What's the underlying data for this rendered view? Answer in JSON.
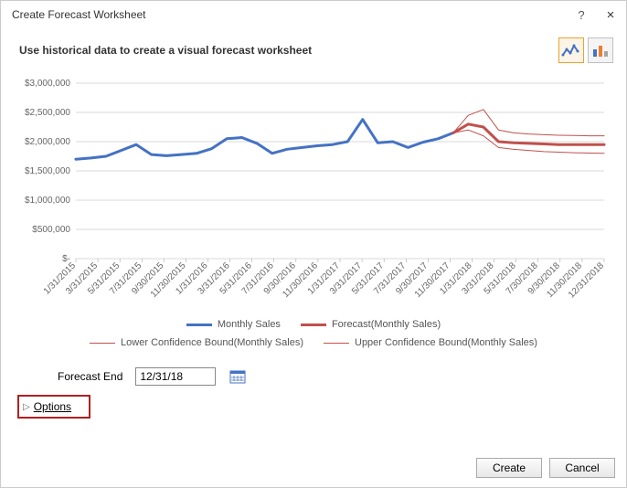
{
  "dialog": {
    "title": "Create Forecast Worksheet",
    "subtitle": "Use historical data to create a visual forecast worksheet",
    "help_tooltip": "?",
    "close_tooltip": "×"
  },
  "chart_types": {
    "line_selected": true,
    "bar_selected": false
  },
  "form": {
    "forecast_end_label": "Forecast End",
    "forecast_end_value": "12/31/18"
  },
  "options": {
    "label": "Options"
  },
  "buttons": {
    "create": "Create",
    "cancel": "Cancel"
  },
  "legend": {
    "monthly_sales": "Monthly Sales",
    "forecast": "Forecast(Monthly Sales)",
    "lower": "Lower Confidence Bound(Monthly Sales)",
    "upper": "Upper Confidence Bound(Monthly Sales)"
  },
  "colors": {
    "historical": "#4472c4",
    "forecast": "#c0504d",
    "bounds": "#c0504d",
    "grid": "#d9d9d9"
  },
  "chart_data": {
    "type": "line",
    "title": "",
    "xlabel": "",
    "ylabel": "",
    "ylim": [
      0,
      3000000
    ],
    "y_ticks": [
      0,
      500000,
      1000000,
      1500000,
      2000000,
      2500000,
      3000000
    ],
    "y_tick_labels": [
      "$-",
      "$500,000",
      "$1,000,000",
      "$1,500,000",
      "$2,000,000",
      "$2,500,000",
      "$3,000,000"
    ],
    "categories": [
      "1/31/2015",
      "3/31/2015",
      "5/31/2015",
      "7/31/2015",
      "9/30/2015",
      "11/30/2015",
      "1/31/2016",
      "3/31/2016",
      "5/31/2016",
      "7/31/2016",
      "9/30/2016",
      "11/30/2016",
      "1/31/2017",
      "3/31/2017",
      "5/31/2017",
      "7/31/2017",
      "9/30/2017",
      "11/30/2017",
      "1/31/2018",
      "3/31/2018",
      "5/31/2018",
      "7/30/2018",
      "9/30/2018",
      "11/30/2018",
      "12/31/2018"
    ],
    "series": [
      {
        "name": "Monthly Sales",
        "color": "#4472c4",
        "width": 3,
        "values": [
          1700000,
          1720000,
          1750000,
          1850000,
          1950000,
          1780000,
          1760000,
          1780000,
          1800000,
          1880000,
          2050000,
          2070000,
          1970000,
          1800000,
          1870000,
          1900000,
          1930000,
          1950000,
          2000000,
          2380000,
          1980000,
          2000000,
          1900000,
          1990000,
          2050000,
          2150000,
          null,
          null,
          null,
          null,
          null,
          null,
          null,
          null,
          null,
          null
        ]
      },
      {
        "name": "Forecast(Monthly Sales)",
        "color": "#c0504d",
        "width": 3,
        "values": [
          null,
          null,
          null,
          null,
          null,
          null,
          null,
          null,
          null,
          null,
          null,
          null,
          null,
          null,
          null,
          null,
          null,
          null,
          null,
          null,
          null,
          null,
          null,
          null,
          null,
          2150000,
          2300000,
          2250000,
          2000000,
          1980000,
          1970000,
          1960000,
          1950000,
          1950000,
          1950000,
          1950000
        ]
      },
      {
        "name": "Lower Confidence Bound(Monthly Sales)",
        "color": "#c0504d",
        "width": 1,
        "values": [
          null,
          null,
          null,
          null,
          null,
          null,
          null,
          null,
          null,
          null,
          null,
          null,
          null,
          null,
          null,
          null,
          null,
          null,
          null,
          null,
          null,
          null,
          null,
          null,
          null,
          2150000,
          2200000,
          2100000,
          1900000,
          1870000,
          1850000,
          1830000,
          1820000,
          1810000,
          1805000,
          1800000
        ]
      },
      {
        "name": "Upper Confidence Bound(Monthly Sales)",
        "color": "#c0504d",
        "width": 1,
        "values": [
          null,
          null,
          null,
          null,
          null,
          null,
          null,
          null,
          null,
          null,
          null,
          null,
          null,
          null,
          null,
          null,
          null,
          null,
          null,
          null,
          null,
          null,
          null,
          null,
          null,
          2150000,
          2450000,
          2550000,
          2200000,
          2150000,
          2130000,
          2120000,
          2110000,
          2105000,
          2100000,
          2100000
        ]
      }
    ]
  }
}
